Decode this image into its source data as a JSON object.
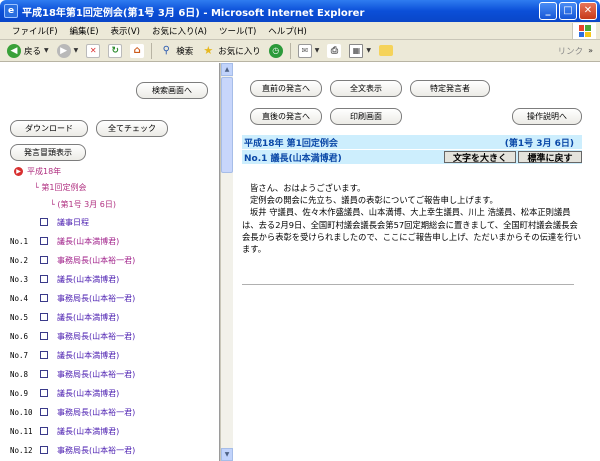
{
  "window": {
    "title": "平成18年第1回定例会(第1号 3月 6日) - Microsoft Internet Explorer",
    "icon": "ie-icon"
  },
  "menu": [
    "ファイル(F)",
    "編集(E)",
    "表示(V)",
    "お気に入り(A)",
    "ツール(T)",
    "ヘルプ(H)"
  ],
  "toolbar": {
    "back": "戻る",
    "search": "検索",
    "favorites": "お気に入り",
    "links": "リンク"
  },
  "left": {
    "search_screen": "検索画面へ",
    "download": "ダウンロード",
    "check_all": "全てチェック",
    "speaker_list": "発言冒頭表示",
    "tree_year": "平成18年",
    "tree_session": "第1回定例会",
    "tree_issue": "(第1号 3月 6日)",
    "agenda": "議事日程",
    "items": [
      {
        "no": "No.1",
        "label": "議長(山本満博君)",
        "kind": "chair"
      },
      {
        "no": "No.2",
        "label": "事務局長(山本裕一君)",
        "kind": "clerk"
      },
      {
        "no": "No.3",
        "label": "議長(山本満博君)",
        "kind": "chair"
      },
      {
        "no": "No.4",
        "label": "事務局長(山本裕一君)",
        "kind": "clerk"
      },
      {
        "no": "No.5",
        "label": "議長(山本満博君)",
        "kind": "chair"
      },
      {
        "no": "No.6",
        "label": "事務局長(山本裕一君)",
        "kind": "clerk"
      },
      {
        "no": "No.7",
        "label": "議長(山本満博君)",
        "kind": "chair"
      },
      {
        "no": "No.8",
        "label": "事務局長(山本裕一君)",
        "kind": "clerk"
      },
      {
        "no": "No.9",
        "label": "議長(山本満博君)",
        "kind": "chair"
      },
      {
        "no": "No.10",
        "label": "事務局長(山本裕一君)",
        "kind": "clerk"
      },
      {
        "no": "No.11",
        "label": "議長(山本満博君)",
        "kind": "chair"
      },
      {
        "no": "No.12",
        "label": "事務局長(山本裕一君)",
        "kind": "clerk"
      }
    ]
  },
  "right": {
    "prev_speech": "直前の発言へ",
    "full_text": "全文表示",
    "specific_speaker": "特定発言者",
    "next_speech": "直後の発言へ",
    "print_screen": "印刷画面",
    "help": "操作説明へ",
    "session_title": "平成18年 第1回定例会",
    "session_date": "(第1号 3月 6日)",
    "speaker": "No.1 議長(山本満博君)",
    "enlarge_text": "文字を大きく",
    "reset_text": "標準に戻す",
    "body": [
      "皆さん、おはようございます。",
      "定例会の開会に先立ち、議員の表彰についてご報告申し上げます。",
      "坂井 守議員、佐々木作盛議員、山本満博、大上幸生議員、川上 浩議員、松本正則議員は、去る2月9日、全国町村議会議長会第57回定期総会に置きまして、全国町村議会議長会会長から表彰を受けられましたので、ここにご報告申し上げ、ただいまからその伝達を行います。"
    ]
  }
}
